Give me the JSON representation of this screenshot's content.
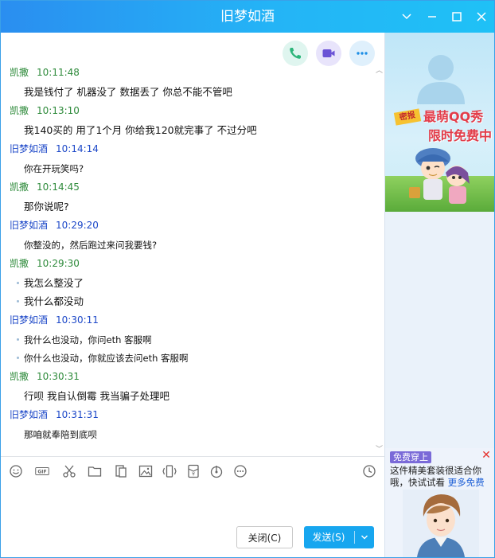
{
  "window": {
    "title": "旧梦如酒"
  },
  "messages": [
    {
      "sender": "凯撒",
      "time": "10:11:48",
      "color": "green",
      "lines": [
        "我是钱付了 机器没了 数据丢了 你总不能不管吧"
      ]
    },
    {
      "sender": "凯撒",
      "time": "10:13:10",
      "color": "green",
      "lines": [
        "我140买的 用了1个月 你给我120就完事了 不过分吧"
      ]
    },
    {
      "sender": "旧梦如酒",
      "time": "10:14:14",
      "color": "blue",
      "lines": [
        "你在开玩笑吗?"
      ]
    },
    {
      "sender": "凯撒",
      "time": "10:14:45",
      "color": "green",
      "lines": [
        "那你说呢?"
      ]
    },
    {
      "sender": "旧梦如酒",
      "time": "10:29:20",
      "color": "blue",
      "lines": [
        "你整没的，然后跑过来问我要钱?"
      ]
    },
    {
      "sender": "凯撒",
      "time": "10:29:30",
      "color": "green",
      "lines": [
        "我怎么整没了",
        "我什么都没动"
      ]
    },
    {
      "sender": "旧梦如酒",
      "time": "10:30:11",
      "color": "blue",
      "lines": [
        "我什么也没动，你问eth 客服啊",
        "你什么也没动，你就应该去问eth 客服啊"
      ]
    },
    {
      "sender": "凯撒",
      "time": "10:30:31",
      "color": "green",
      "lines": [
        "行呗 我自认倒霉 我当骗子处理吧"
      ]
    },
    {
      "sender": "旧梦如酒",
      "time": "10:31:31",
      "color": "blue",
      "lines": [
        "那咱就奉陪到底呗"
      ]
    }
  ],
  "buttons": {
    "close": "关闭(C)",
    "send": "发送(S)"
  },
  "ad": {
    "tag": "密报",
    "line1": "最萌QQ秀",
    "line2": "限时免费中"
  },
  "dress": {
    "badge": "免费穿上",
    "text": "这件精美套装很适合你哦，快试试看",
    "link": "更多免费"
  },
  "colors": {
    "titlebar_start": "#2a8ef0",
    "titlebar_end": "#1fc1f6",
    "sender_self": "#2d8a3a",
    "sender_other": "#1d48c8",
    "send_button": "#17a6ef"
  }
}
